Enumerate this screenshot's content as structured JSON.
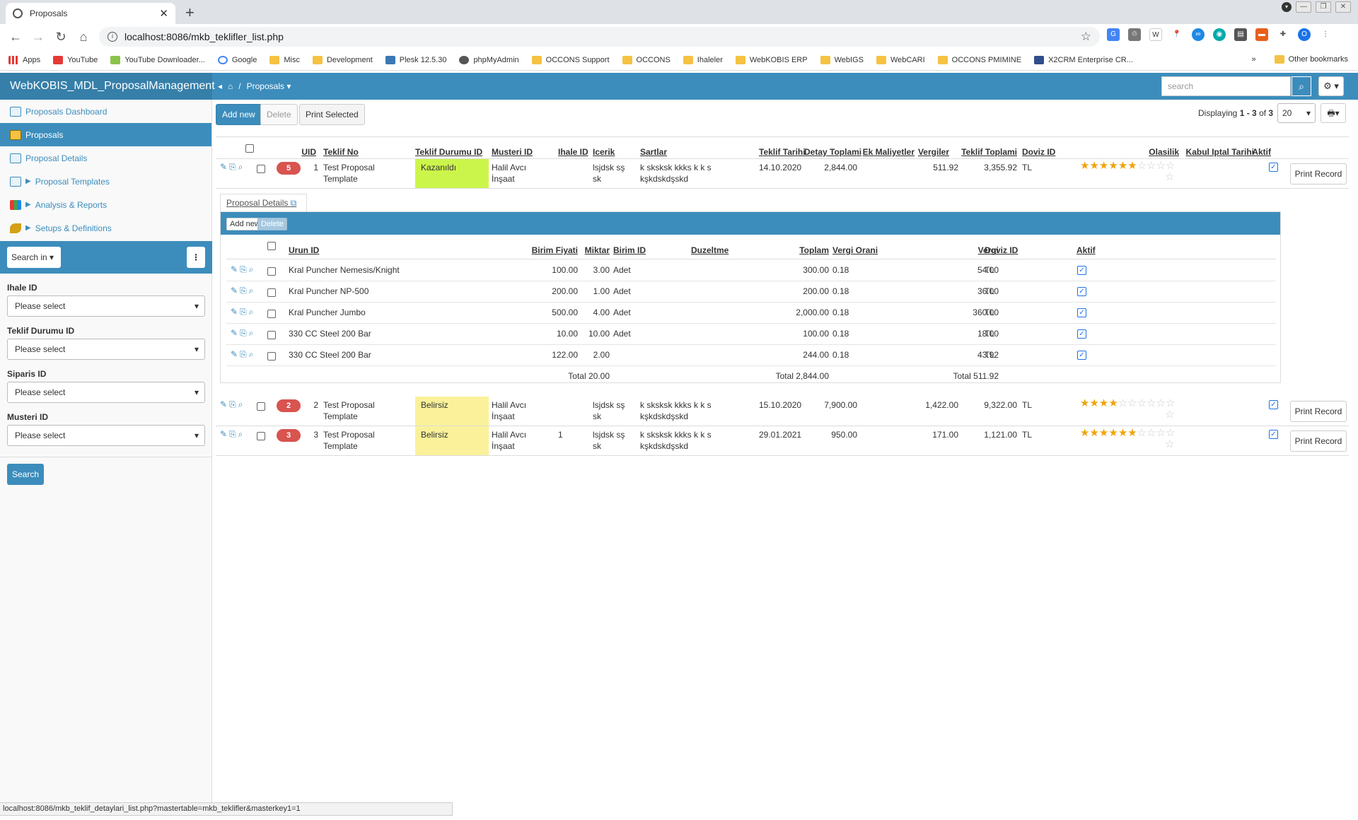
{
  "browser": {
    "tab_title": "Proposals",
    "url": "localhost:8086/mkb_teklifler_list.php",
    "bookmarks": [
      "Apps",
      "YouTube",
      "YouTube Downloader...",
      "Google",
      "Misc",
      "Development",
      "Plesk 12.5.30",
      "phpMyAdmin",
      "OCCONS Support",
      "OCCONS",
      "Ihaleler",
      "WebKOBIS ERP",
      "WebIGS",
      "WebCARI",
      "OCCONS PMIMINE",
      "X2CRM Enterprise CR..."
    ],
    "other_bookmarks": "Other bookmarks",
    "profile_initial": "O",
    "status_url": "localhost:8086/mkb_teklif_detaylari_list.php?mastertable=mkb_teklifler&masterkey1=1"
  },
  "app": {
    "brand": "WebKOBIS_MDL_ProposalManagement",
    "breadcrumb": "Proposals",
    "search_placeholder": "search"
  },
  "sidebar": {
    "items": [
      {
        "label": "Proposals Dashboard",
        "icon": "dashboard-icon"
      },
      {
        "label": "Proposals",
        "icon": "proposals-icon",
        "active": true
      },
      {
        "label": "Proposal Details",
        "icon": "details-icon"
      },
      {
        "label": "Proposal Templates",
        "icon": "templates-icon",
        "expandable": true
      },
      {
        "label": "Analysis & Reports",
        "icon": "chart-icon",
        "expandable": true
      },
      {
        "label": "Setups & Definitions",
        "icon": "wrench-icon",
        "expandable": true
      }
    ],
    "search_in": "Search in",
    "filters": [
      {
        "label": "Ihale ID",
        "value": "Please select"
      },
      {
        "label": "Teklif Durumu ID",
        "value": "Please select"
      },
      {
        "label": "Siparis ID",
        "value": "Please select"
      },
      {
        "label": "Musteri ID",
        "value": "Please select"
      }
    ],
    "search_button": "Search"
  },
  "toolbar": {
    "add_new": "Add new",
    "delete": "Delete",
    "print_selected": "Print Selected",
    "displaying_prefix": "Displaying",
    "range": "1 - 3",
    "of": "of",
    "total": "3",
    "page_size": "20"
  },
  "grid": {
    "headers": [
      "UID",
      "Teklif No",
      "Teklif Durumu ID",
      "Musteri ID",
      "Ihale ID",
      "Icerik",
      "Sartlar",
      "Teklif Tarihi",
      "Detay Toplami",
      "Ek Maliyetler",
      "Vergiler",
      "Teklif Toplami",
      "Doviz ID",
      "Olasilik",
      "Kabul Iptal Tarihi",
      "Aktif"
    ],
    "print_label": "Print Record",
    "rows": [
      {
        "badge": "5",
        "uid": "1",
        "teklif_no": "Test Proposal Template",
        "durum": "Kazanıldı",
        "musteri": "Halil Avcı İnşaat",
        "ihale": "",
        "icerik": "lsjdsk sş sk",
        "sartlar": "k sksksk kkks k k s kşkdskdşskd",
        "tarih": "14.10.2020",
        "detay": "2,844.00",
        "ek": "",
        "vergi": "511.92",
        "toplam": "3,355.92",
        "doviz": "TL",
        "olasilik": 6,
        "kabul": "",
        "aktif": true
      },
      {
        "badge": "2",
        "uid": "2",
        "teklif_no": "Test Proposal Template",
        "durum": "Belirsiz",
        "musteri": "Halil Avcı İnşaat",
        "ihale": "",
        "icerik": "lsjdsk sş sk",
        "sartlar": "k sksksk kkks k k s kşkdskdşskd",
        "tarih": "15.10.2020",
        "detay": "7,900.00",
        "ek": "",
        "vergi": "1,422.00",
        "toplam": "9,322.00",
        "doviz": "TL",
        "olasilik": 4,
        "kabul": "",
        "aktif": true
      },
      {
        "badge": "3",
        "uid": "3",
        "teklif_no": "Test Proposal Template",
        "durum": "Belirsiz",
        "musteri": "Halil Avcı İnşaat",
        "ihale": "1",
        "icerik": "lsjdsk sş sk",
        "sartlar": "k sksksk kkks k k s kşkdskdşskd",
        "tarih": "29.01.2021",
        "detay": "950.00",
        "ek": "",
        "vergi": "171.00",
        "toplam": "1,121.00",
        "doviz": "TL",
        "olasilik": 6,
        "kabul": "",
        "aktif": true
      }
    ]
  },
  "details": {
    "tab_label": "Proposal Details",
    "add_new": "Add new",
    "delete": "Delete",
    "headers": [
      "Urun ID",
      "Birim Fiyati",
      "Miktar",
      "Birim ID",
      "Duzeltme",
      "Toplam",
      "Vergi Orani",
      "Vergi",
      "Doviz ID",
      "Aktif"
    ],
    "rows": [
      {
        "urun": "Kral Puncher Nemesis/Knight",
        "fiyat": "100.00",
        "miktar": "3.00",
        "birim": "Adet",
        "duzeltme": "",
        "toplam": "300.00",
        "oran": "0.18",
        "vergi": "54.00",
        "doviz": "TL"
      },
      {
        "urun": "Kral Puncher NP-500",
        "fiyat": "200.00",
        "miktar": "1.00",
        "birim": "Adet",
        "duzeltme": "",
        "toplam": "200.00",
        "oran": "0.18",
        "vergi": "36.00",
        "doviz": "TL"
      },
      {
        "urun": "Kral Puncher Jumbo",
        "fiyat": "500.00",
        "miktar": "4.00",
        "birim": "Adet",
        "duzeltme": "",
        "toplam": "2,000.00",
        "oran": "0.18",
        "vergi": "360.00",
        "doviz": "TL"
      },
      {
        "urun": "330 CC Steel 200 Bar",
        "fiyat": "10.00",
        "miktar": "10.00",
        "birim": "Adet",
        "duzeltme": "",
        "toplam": "100.00",
        "oran": "0.18",
        "vergi": "18.00",
        "doviz": "TL"
      },
      {
        "urun": "330 CC Steel 200 Bar",
        "fiyat": "122.00",
        "miktar": "2.00",
        "birim": "",
        "duzeltme": "",
        "toplam": "244.00",
        "oran": "0.18",
        "vergi": "43.92",
        "doviz": "TL"
      }
    ],
    "totals": {
      "miktar": "Total 20.00",
      "toplam": "Total 2,844.00",
      "vergi": "Total 511.92"
    }
  },
  "colors": {
    "accent": "#3c8dbc",
    "status_won": "#ccf54b",
    "status_pending": "#faf19a",
    "star": "#f0a30a"
  }
}
